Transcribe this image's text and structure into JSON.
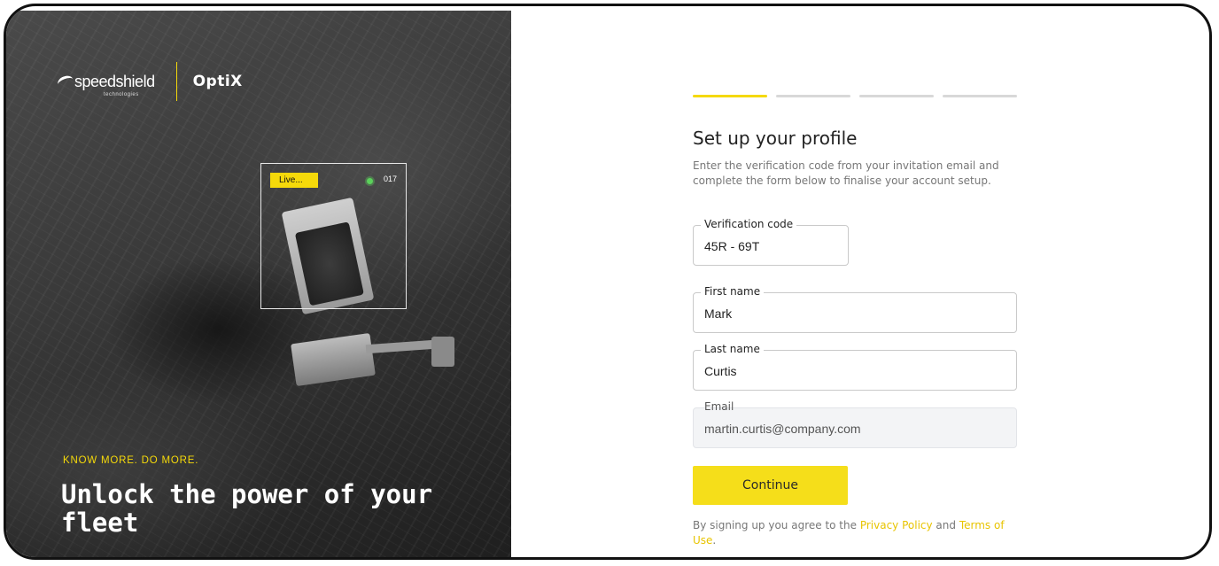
{
  "hero": {
    "brand_name": "speedshield",
    "brand_sub": "technologies",
    "product_name": "OptiX",
    "live_label": "Live...",
    "unit_id": "017",
    "tagline": "KNOW MORE. DO MORE.",
    "headline": "Unlock the power of your fleet",
    "accent_color": "#f5d90a",
    "live_dot_color": "#5bd15b"
  },
  "form": {
    "steps": [
      {
        "active": true
      },
      {
        "active": false
      },
      {
        "active": false
      },
      {
        "active": false
      }
    ],
    "title": "Set up your profile",
    "description": "Enter the verification code from your invitation email and complete the form below to finalise your account setup.",
    "fields": {
      "verification_code": {
        "label": "Verification code",
        "value": "45R - 69T"
      },
      "first_name": {
        "label": "First name",
        "value": "Mark"
      },
      "last_name": {
        "label": "Last name",
        "value": "Curtis"
      },
      "email": {
        "label": "Email",
        "value": "martin.curtis@company.com",
        "disabled": true
      }
    },
    "continue_label": "Continue",
    "legal": {
      "prefix": "By signing up you agree to the ",
      "privacy": "Privacy Policy",
      "and": " and ",
      "terms": "Terms of Use",
      "suffix": "."
    }
  }
}
